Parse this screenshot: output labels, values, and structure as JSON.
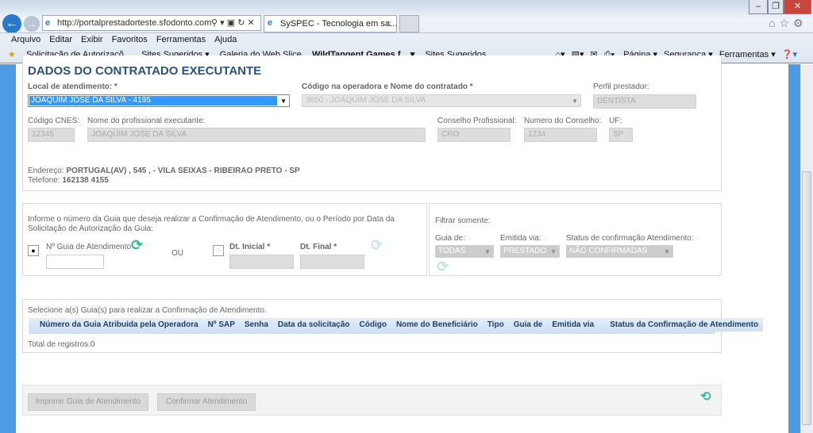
{
  "browser": {
    "url": "http://portalprestadorteste.sfodonto.com.br/PL",
    "tab_title": "SySPEC - Tecnologia em sa...",
    "menu": [
      "Arquivo",
      "Editar",
      "Exibir",
      "Favoritos",
      "Ferramentas",
      "Ajuda"
    ],
    "favorites": [
      "Solicitação de Autorizaçõ...",
      "Sites Sugeridos ▾",
      "Galeria do Web Slice",
      "WildTangent Games f... ▾",
      "Sites Sugeridos"
    ],
    "commands": [
      "Página ▾",
      "Segurança ▾",
      "Ferramentas ▾"
    ]
  },
  "contratado": {
    "title": "DADOS DO CONTRATADO EXECUTANTE",
    "local_label": "Local de atendimento: *",
    "local_value": "JOAQUIM JOSE DA SILVA - 4195",
    "codigo_label": "Código na operadora e Nome do contratado *",
    "codigo_value": "3650 - JOAQUIM JOSE DA SILVA",
    "perfil_label": "Perfil prestador:",
    "perfil_value": "DENTISTA",
    "cnes_label": "Código CNES:",
    "cnes_value": "12345",
    "nome_label": "Nome do profissional executante:",
    "nome_value": "JOAQUIM JOSE DA SILVA",
    "conselho_label": "Conselho Profissional:",
    "conselho_value": "CRO",
    "numero_label": "Numero do Conselho:",
    "numero_value": "1234",
    "uf_label": "UF:",
    "uf_value": "SP",
    "endereco_label": "Endereço:",
    "endereco_value": "PORTUGAL(AV) , 545 , - VILA SEIXAS - RIBEIRAO PRETO - SP",
    "telefone_label": "Telefone:",
    "telefone_value": "162138 4155"
  },
  "busca": {
    "instrucao": "Informe o número da Guia que deseja realizar a Confirmação de Atendimento, ou o Período por Data da Solicitação de Autorização da Guia:",
    "guia_label": "Nº Guia de Atendimento",
    "guia_value": "",
    "ou": "OU",
    "dt_inicial_label": "Dt. Inicial *",
    "dt_final_label": "Dt. Final *"
  },
  "filtro": {
    "title": "Filtrar somente:",
    "guia_de_label": "Guia de:",
    "guia_de_value": "TODAS",
    "emitida_label": "Emitida via:",
    "emitida_value": "PRESTADO",
    "status_label": "Status de confirmação Atendimento:",
    "status_value": "NÃO CONFIRMADAS"
  },
  "resultado": {
    "instrucao": "Selecione a(s) Guia(s) para realizar a Confirmação de Atendimento.",
    "columns": [
      "Número da Guia Atribuida pela Operadora",
      "Nº SAP",
      "Senha",
      "Data da solicitação",
      "Código",
      "Nome do Beneficiário",
      "Tipo",
      "Guia de",
      "Emitida via",
      "Status da Confirmação de Atendimento"
    ],
    "total": "Total de registros:0"
  },
  "actions": {
    "imprimir": "Imprimir Guia de Atendimento",
    "confirmar": "Confirmar Atendimento"
  },
  "colors": {
    "accent_blue": "#4e9be4",
    "title_blue": "#2b5278",
    "refresh": "#3cb8a0",
    "selected": "#3399ff"
  }
}
